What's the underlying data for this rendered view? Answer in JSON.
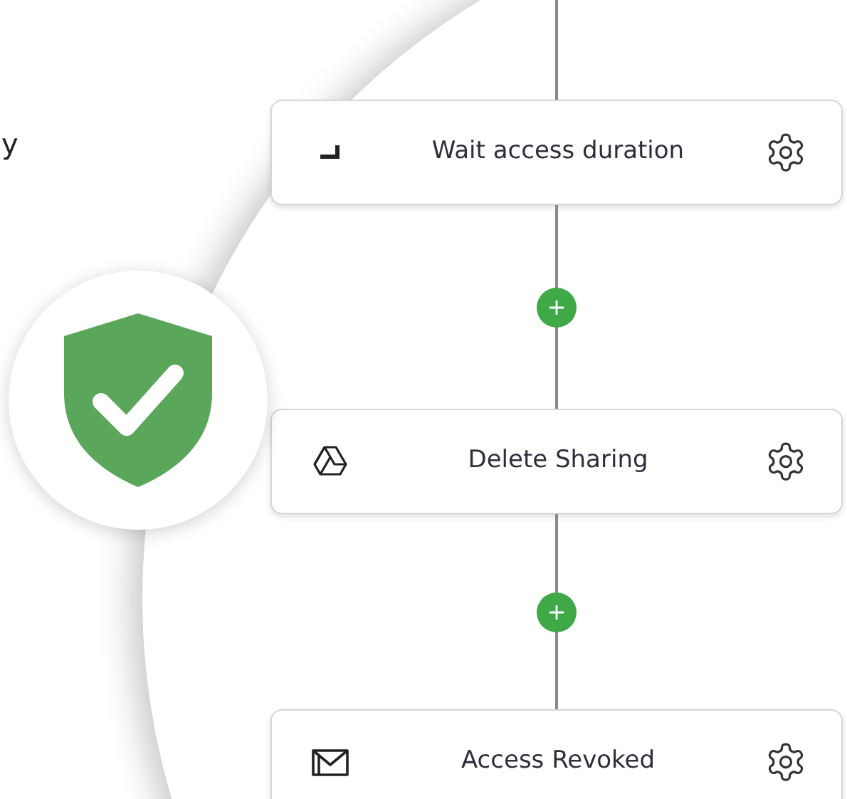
{
  "side_text": "y",
  "steps": [
    {
      "kind": "timer",
      "label": "Wait access duration"
    },
    {
      "kind": "drive",
      "label": "Delete Sharing"
    },
    {
      "kind": "mail",
      "label": "Access Revoked"
    }
  ]
}
